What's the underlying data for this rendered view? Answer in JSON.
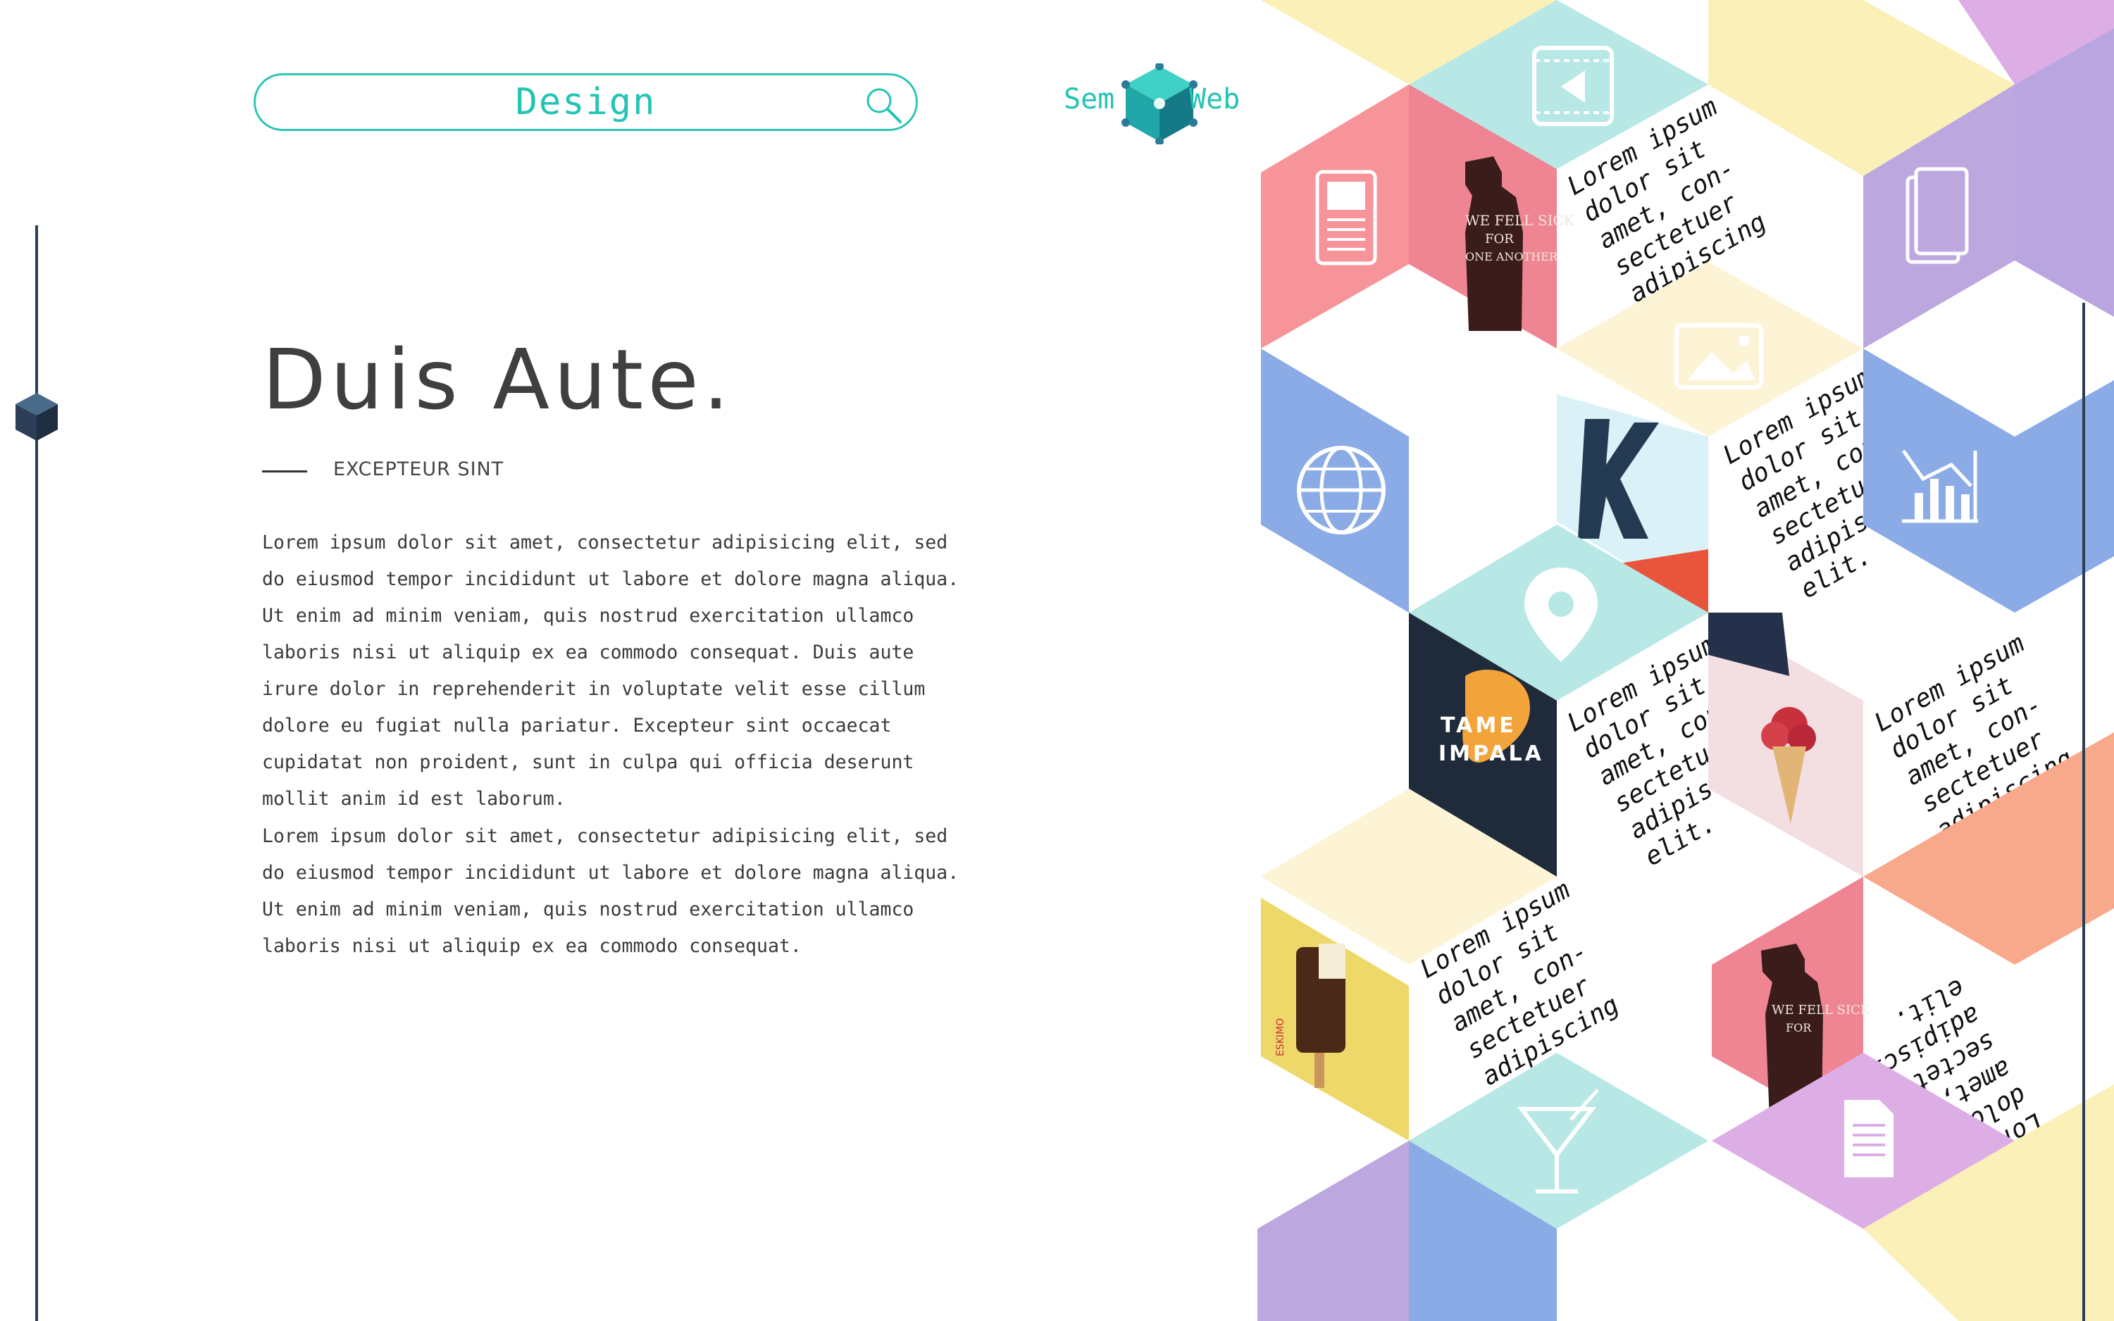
{
  "search": {
    "value": "Design"
  },
  "logo": {
    "left_word": "Sem",
    "right_word": "Web"
  },
  "hero": {
    "title": "Duis Aute.",
    "subtitle": "EXCEPTEUR SINT",
    "paragraph_1": "Lorem ipsum dolor sit amet, consectetur adipisicing elit, sed do eiusmod tempor incididunt ut labore et dolore magna aliqua. Ut enim ad minim veniam, quis nostrud exercitation ullamco laboris nisi ut aliquip ex ea commodo consequat. Duis aute irure dolor in reprehenderit in voluptate velit esse cillum dolore eu fugiat nulla pariatur. Excepteur sint occaecat cupidatat non proident, sunt in culpa qui officia deserunt mollit anim id est laborum.",
    "paragraph_2": "Lorem ipsum dolor sit amet, consectetur adipisicing elit, sed do eiusmod tempor incididunt ut labore et dolore magna aliqua. Ut enim ad minim veniam, quis nostrud exercitation ullamco laboris nisi ut aliquip ex ea commodo consequat."
  },
  "mosaic": {
    "tile_text_lines": [
      "Lorem ipsum",
      "dolor sit",
      "amet, con-",
      "sectetuer",
      "adipiscing",
      "elit."
    ],
    "poster_text": {
      "bottle_1": "WE FELL SICK",
      "bottle_2": "FOR",
      "bottle_3": "ONE ANOTHER",
      "tame": "TAME",
      "impala": "IMPALA",
      "eskimo": "ESKIMO"
    },
    "icons": [
      "video-icon",
      "document-icon",
      "files-icon",
      "image-icon",
      "globe-icon",
      "chart-icon",
      "location-pin-icon",
      "cocktail-icon",
      "page-icon"
    ]
  },
  "colors": {
    "accent": "#22c4b3",
    "rail": "#2b3e55",
    "heading": "#3f3f3f",
    "pink": "#f7949a",
    "yellow": "#fbf0b8",
    "teal": "#b7e8e6",
    "purple": "#bca7df",
    "blue": "#8aabe6",
    "orange": "#f9a98b",
    "lilac": "#ddaee6"
  }
}
